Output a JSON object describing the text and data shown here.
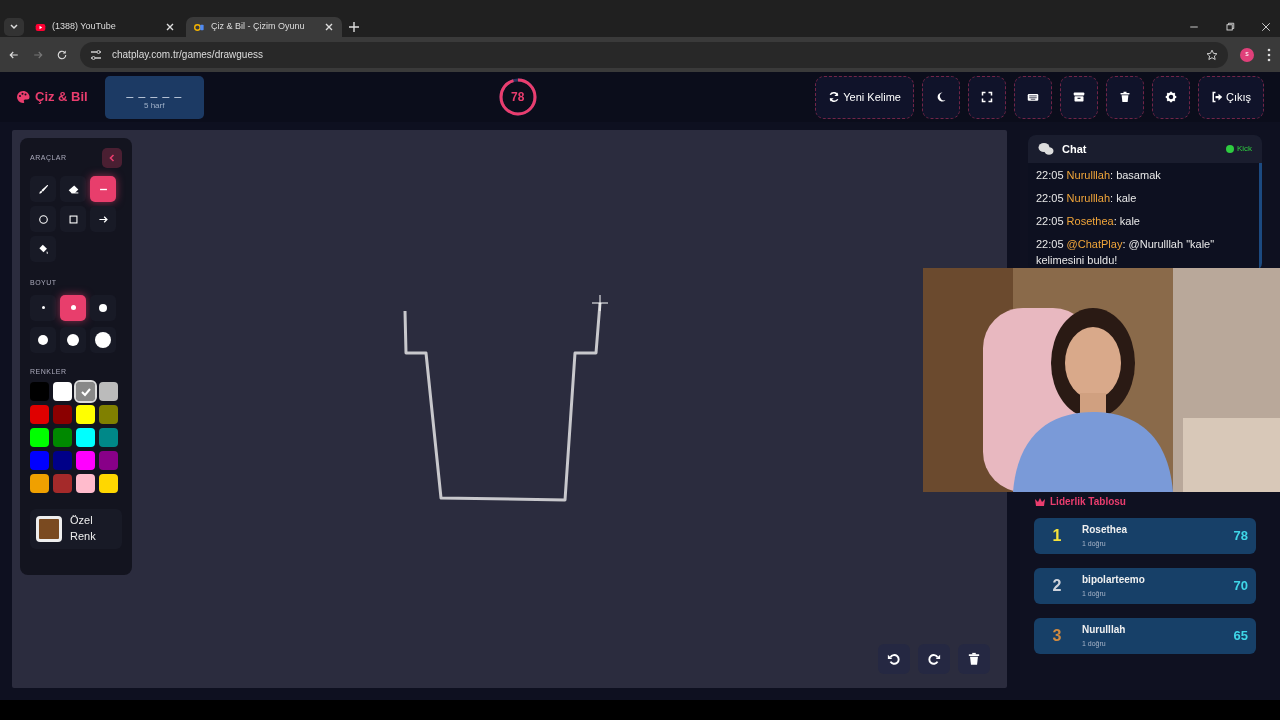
{
  "browser": {
    "tabs": [
      {
        "title": "(1388) YouTube",
        "kind": "youtube",
        "selected": false
      },
      {
        "title": "Çiz & Bil - Çizim Oyunu",
        "kind": "cp",
        "selected": true
      }
    ],
    "url": "chatplay.com.tr/games/drawguess",
    "profile": "s"
  },
  "header": {
    "logo": "Çiz & Bil",
    "word": {
      "mask": "_ _ _ _ _",
      "hint": "5 harf"
    },
    "timer": {
      "text": "78"
    },
    "buttons": [
      {
        "kind": "refresh",
        "label": "Yeni Kelime"
      },
      {
        "kind": "moon"
      },
      {
        "kind": "fullscreen"
      },
      {
        "kind": "keyboard"
      },
      {
        "kind": "archive"
      },
      {
        "kind": "trash"
      },
      {
        "kind": "gear"
      },
      {
        "kind": "logout",
        "label": "Çıkış"
      }
    ]
  },
  "tools_panel": {
    "title": "ARAÇLAR",
    "tools": [
      {
        "kind": "brush",
        "selected": false
      },
      {
        "kind": "eraser",
        "selected": false
      },
      {
        "kind": "line",
        "selected": true
      },
      {
        "kind": "circle",
        "selected": false
      },
      {
        "kind": "square",
        "selected": false
      },
      {
        "kind": "arrow",
        "selected": false
      },
      {
        "kind": "fill",
        "selected": false
      }
    ],
    "size_title": "BOYUT",
    "sizes": [
      {
        "selected": false
      },
      {
        "selected": true
      },
      {
        "selected": false
      },
      {
        "selected": false
      },
      {
        "selected": false
      },
      {
        "selected": false
      }
    ],
    "colors_title": "RENKLER",
    "colors": [
      {
        "color": "#000000",
        "selected": false
      },
      {
        "color": "#ffffff",
        "selected": false
      },
      {
        "color": "#888888",
        "selected": true
      },
      {
        "color": "#bbbbbb",
        "selected": false
      },
      {
        "color": "#e00000",
        "selected": false
      },
      {
        "color": "#8b0000",
        "selected": false
      },
      {
        "color": "#ffff00",
        "selected": false
      },
      {
        "color": "#808000",
        "selected": false
      },
      {
        "color": "#00ff00",
        "selected": false
      },
      {
        "color": "#008800",
        "selected": false
      },
      {
        "color": "#00ffff",
        "selected": false
      },
      {
        "color": "#008888",
        "selected": false
      },
      {
        "color": "#0000ff",
        "selected": false
      },
      {
        "color": "#000088",
        "selected": false
      },
      {
        "color": "#ff00ff",
        "selected": false
      },
      {
        "color": "#880088",
        "selected": false
      },
      {
        "color": "#f0a000",
        "selected": false
      },
      {
        "color": "#a52a2a",
        "selected": false
      },
      {
        "color": "#ffbbcc",
        "selected": false
      },
      {
        "color": "#ffd700",
        "selected": false
      }
    ],
    "custom": {
      "label": "Özel Renk",
      "color": "#7a4a20"
    }
  },
  "canvas_controls": [
    {
      "kind": "undo"
    },
    {
      "kind": "redo"
    },
    {
      "kind": "trash"
    }
  ],
  "chat": {
    "title": "Chat",
    "status": "Kick",
    "messages": [
      {
        "time": "22:05",
        "user": "Nurulllah",
        "text": ": basamak"
      },
      {
        "time": "22:05",
        "user": "Nurulllah",
        "text": ": kale"
      },
      {
        "time": "22:05",
        "user": "Rosethea",
        "text": ": kale"
      },
      {
        "time": "22:05",
        "user": "@ChatPlay",
        "text": ": @Nurulllah \"kale\" kelimesini buldu!"
      }
    ]
  },
  "leaderboard": {
    "title": "Liderlik Tablosu",
    "entries": [
      {
        "rank": "1",
        "name": "Rosethea",
        "sub": "1 doğru",
        "score": "78",
        "color": "#f5e23a"
      },
      {
        "rank": "2",
        "name": "bipolarteemo",
        "sub": "1 doğru",
        "score": "70",
        "color": "#d0d4dc"
      },
      {
        "rank": "3",
        "name": "Nurulllah",
        "sub": "1 doğru",
        "score": "65",
        "color": "#d08a40"
      }
    ]
  }
}
